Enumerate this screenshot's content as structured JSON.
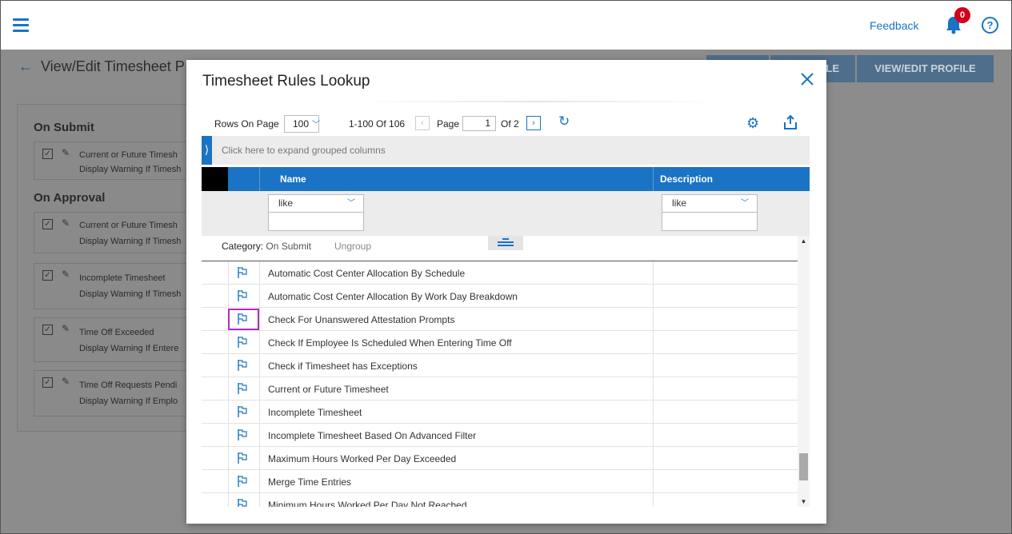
{
  "topbar": {
    "feedback_label": "Feedback",
    "notification_count": "0",
    "help_label": "?"
  },
  "background": {
    "page_title": "View/Edit Timesheet P",
    "buttons": [
      "LE",
      "VIEW/EDIT PROFILE"
    ],
    "section_on_submit": "On Submit",
    "section_on_approval": "On Approval",
    "cards": [
      {
        "line1": "Current or Future Timesh",
        "line2": "Display Warning If Timesh"
      },
      {
        "line1": "Current or Future Timesh",
        "line2": "Display Warning If Timesh"
      },
      {
        "line1": "Incomplete Timesheet",
        "line2": "Display Warning If Timesh"
      },
      {
        "line1": "Time Off Exceeded",
        "line2": "Display Warning If Entere"
      },
      {
        "line1": "Time Off Requests Pendi",
        "line2": "Display Warning If Emplo"
      }
    ]
  },
  "modal": {
    "title": "Timesheet Rules Lookup",
    "close_label": "X",
    "toolbar": {
      "rows_on_page_label": "Rows On Page",
      "rows_on_page_value": "100",
      "range": "1-100 Of 106",
      "page_label": "Page",
      "page_value": "1",
      "page_total": "Of 2"
    },
    "group_bar_text": "Click here to expand grouped columns",
    "columns": {
      "name": "Name",
      "description": "Description"
    },
    "filters": {
      "name_operator": "like",
      "description_operator": "like"
    },
    "group_row": {
      "category_label": "Category:",
      "category_value": "On Submit",
      "ungroup_label": "Ungroup"
    },
    "rows": [
      "Automatic Cost Center Allocation By Schedule",
      "Automatic Cost Center Allocation By Work Day Breakdown",
      "Check For Unanswered Attestation Prompts",
      "Check If Employee Is Scheduled When Entering Time Off",
      "Check if Timesheet has Exceptions",
      "Current or Future Timesheet",
      "Incomplete Timesheet",
      "Incomplete Timesheet Based On Advanced Filter",
      "Maximum Hours Worked Per Day Exceeded",
      "Merge Time Entries",
      "Minimum Hours Worked Per Day Not Reached"
    ],
    "highlighted_row_index": 2
  },
  "colors": {
    "accent": "#1a73c5",
    "highlight": "#b12cc0",
    "badge": "#d0021b"
  }
}
